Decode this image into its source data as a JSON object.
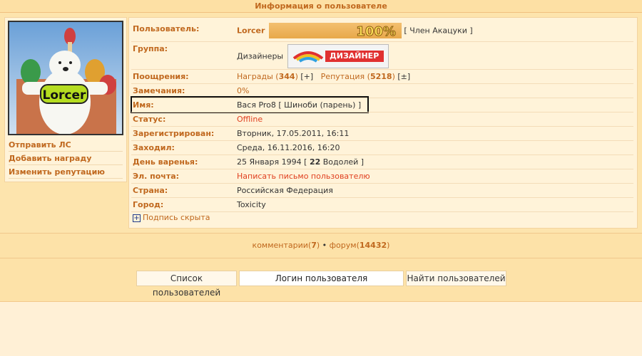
{
  "title": "Информация о пользователе",
  "left": {
    "avatar_text": "Lorcer",
    "links": [
      "Отправить ЛС",
      "Добавить награду",
      "Изменить репутацию"
    ]
  },
  "profile": {
    "user_label": "Пользователь:",
    "username": "Lorcer",
    "rep_percent": "100%",
    "rank": "[ Член Акацуки ]",
    "group_label": "Группа:",
    "group_value": "Дизайнеры",
    "group_banner": "ДИЗАЙНЕР",
    "rewards_label": "Поощрения:",
    "awards_text": "Награды (",
    "awards_count": "344",
    "awards_close": ")",
    "awards_add": "[+]",
    "reputation_text": "Репутация (",
    "reputation_count": "5218",
    "reputation_close": ")",
    "reputation_change": "[±]",
    "warnings_label": "Замечания:",
    "warnings_value": "0%",
    "name_label": "Имя:",
    "name_value": "Вася Pro8 [ Шиноби (парень) ]",
    "status_label": "Статус:",
    "status_value": "Offline",
    "registered_label": "Зарегистрирован:",
    "registered_value": "Вторник, 17.05.2011, 16:11",
    "visited_label": "Заходил:",
    "visited_value": "Среда, 16.11.2016, 16:20",
    "birthday_label": "День варенья:",
    "birthday_value_pre": "25 Января 1994 [ ",
    "birthday_age": "22",
    "birthday_value_post": " Водолей ]",
    "email_label": "Эл. почта:",
    "email_value": "Написать письмо пользователю",
    "country_label": "Страна:",
    "country_value": "Российская Федерация",
    "city_label": "Город:",
    "city_value": "Toxicity",
    "signature_toggle": "Подпись скрыта"
  },
  "stats": {
    "comments_label": "комментарии",
    "comments_count": "7",
    "separator": " • ",
    "forum_label": "форум",
    "forum_count": "14432"
  },
  "search": {
    "list_button": "Список пользователей",
    "login_placeholder": "Логин пользователя",
    "find_button": "Найти пользователей"
  },
  "colors": {
    "accent": "#c0681e",
    "link_red": "#e04020",
    "panel": "#fff3d9",
    "background": "#fde2a8"
  }
}
